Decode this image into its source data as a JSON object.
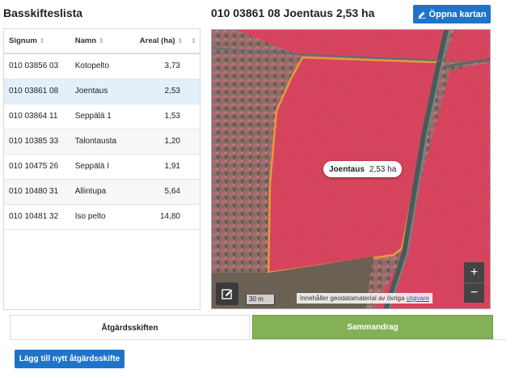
{
  "list": {
    "title": "Basskifteslista",
    "columns": {
      "signum": "Signum",
      "name": "Namn",
      "area": "Areal (ha)"
    },
    "rows": [
      {
        "signum": "010 03856 03",
        "name": "Kotopelto",
        "area": "3,73"
      },
      {
        "signum": "010 03861 08",
        "name": "Joentaus",
        "area": "2,53"
      },
      {
        "signum": "010 03864 11",
        "name": "Seppälä 1",
        "area": "1,53"
      },
      {
        "signum": "010 10385 33",
        "name": "Talontausta",
        "area": "1,20"
      },
      {
        "signum": "010 10475 26",
        "name": "Seppälä I",
        "area": "1,91"
      },
      {
        "signum": "010 10480 31",
        "name": "Allintupa",
        "area": "5,64"
      },
      {
        "signum": "010 10481 32",
        "name": "Iso pelto",
        "area": "14,80"
      }
    ],
    "selected_index": 1
  },
  "detail": {
    "title": "010 03861 08 Joentaus 2,53 ha",
    "open_map_label": "Öppna kartan"
  },
  "map": {
    "tooltip_name": "Joentaus",
    "tooltip_area": "2,53 ha",
    "zoom_in": "+",
    "zoom_out": "−",
    "scale_label": "30 m",
    "attribution_text": "Innehåller geodatamaterial av övriga",
    "attribution_link": "utgivare"
  },
  "tabs": {
    "actions": "Åtgärdsskiften",
    "summary": "Sammandrag"
  },
  "add_button": "Lägg till nytt åtgärdsskifte",
  "colors": {
    "accent": "#1e74c8",
    "summary_tab": "#84b155",
    "field": "#d94860",
    "boundary": "#e79a3a"
  }
}
